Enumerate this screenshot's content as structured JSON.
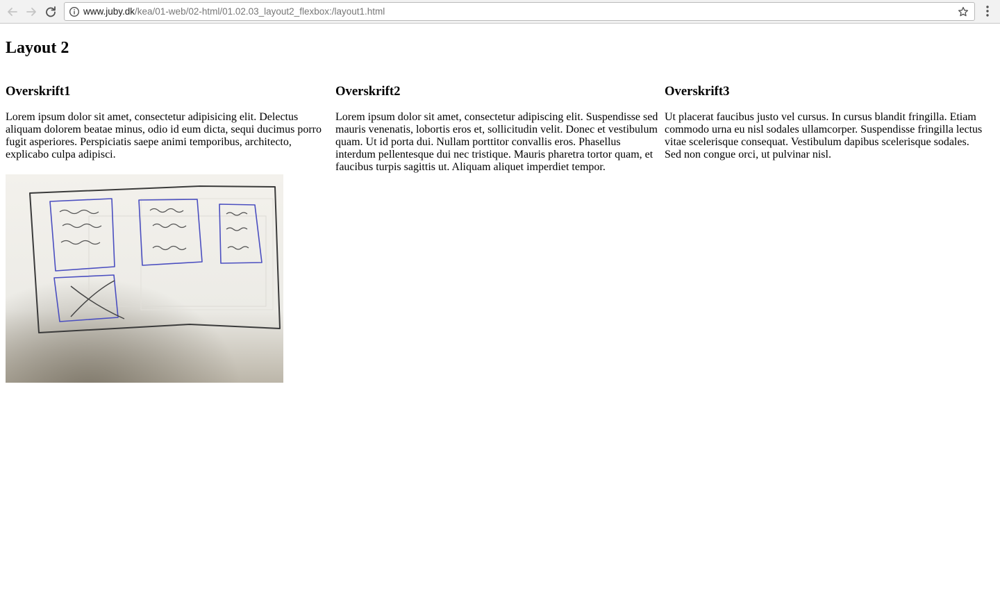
{
  "browser": {
    "url_host": "www.juby.dk",
    "url_path": "/kea/01-web/02-html/01.02.03_layout2_flexbox:/layout1.html"
  },
  "page": {
    "title": "Layout 2",
    "columns": [
      {
        "heading": "Overskrift1",
        "text": "Lorem ipsum dolor sit amet, consectetur adipisicing elit. Delectus aliquam dolorem beatae minus, odio id eum dicta, sequi ducimus porro fugit asperiores. Perspiciatis saepe animi temporibus, architecto, explicabo culpa adipisci."
      },
      {
        "heading": "Overskrift2",
        "text": "Lorem ipsum dolor sit amet, consectetur adipiscing elit. Suspendisse sed mauris venenatis, lobortis eros et, sollicitudin velit. Donec et vestibulum quam. Ut id porta dui. Nullam porttitor convallis eros. Phasellus interdum pellentesque dui nec tristique. Mauris pharetra tortor quam, et faucibus turpis sagittis ut. Aliquam aliquet imperdiet tempor."
      },
      {
        "heading": "Overskrift3",
        "text": "Ut placerat faucibus justo vel cursus. In cursus blandit fringilla. Etiam commodo urna eu nisl sodales ullamcorper. Suspendisse fringilla lectus vitae scelerisque consequat. Vestibulum dapibus scelerisque sodales. Sed non congue orci, ut pulvinar nisl."
      }
    ]
  },
  "icons": {
    "back": "back-arrow-icon",
    "forward": "forward-arrow-icon",
    "reload": "reload-icon",
    "info": "info-icon",
    "bookmark": "star-icon",
    "menu": "vertical-dots-icon"
  },
  "colors": {
    "sketch_ink_blue": "#4a4ec0",
    "sketch_ink_black": "#3a3a3a",
    "paper": "#f1efea"
  }
}
